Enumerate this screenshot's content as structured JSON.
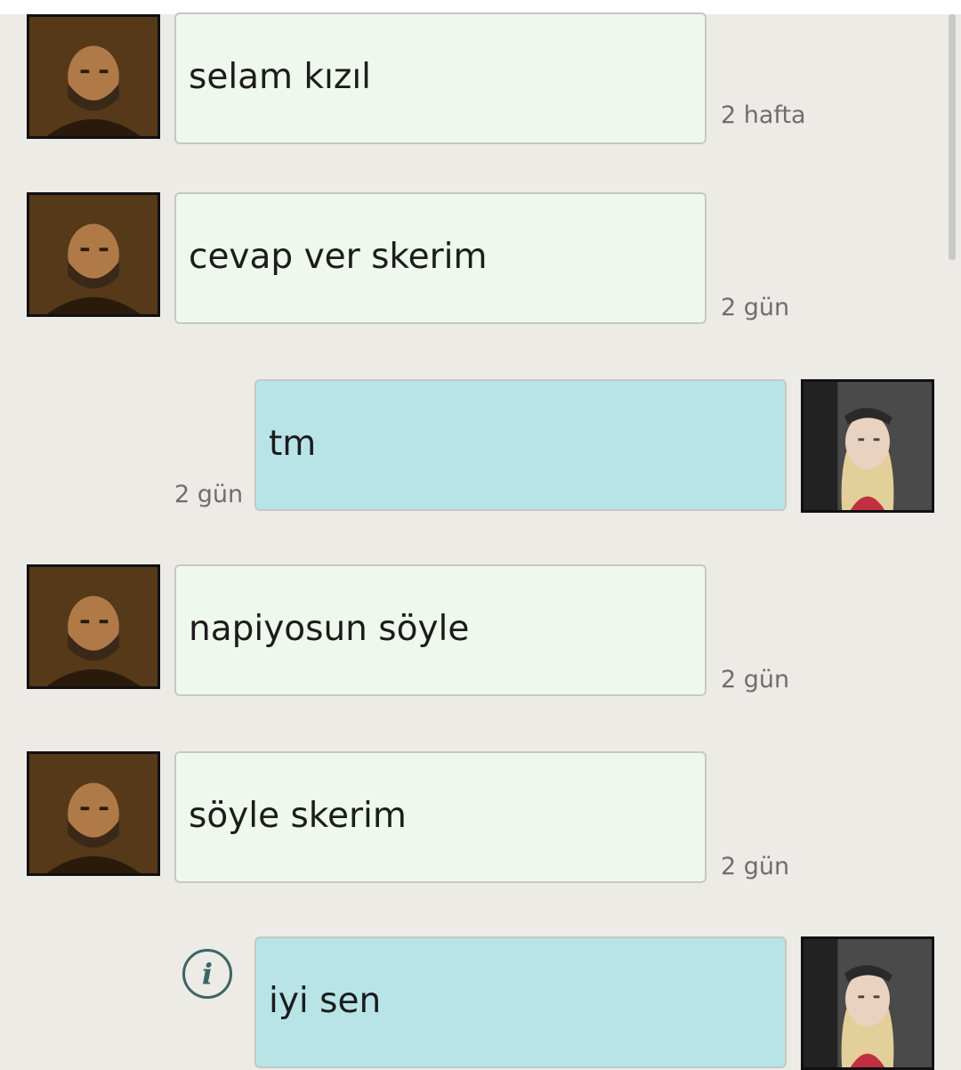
{
  "messages": [
    {
      "side": "in",
      "text": "selam kızıl",
      "time": "2 hafta"
    },
    {
      "side": "in",
      "text": "cevap ver skerim",
      "time": "2 gün"
    },
    {
      "side": "out",
      "text": "tm",
      "time": "2 gün"
    },
    {
      "side": "in",
      "text": "napiyosun söyle",
      "time": "2 gün"
    },
    {
      "side": "in",
      "text": "söyle skerim",
      "time": "2 gün"
    },
    {
      "side": "out",
      "text": "iyi sen",
      "time": ""
    }
  ],
  "info_icon": {
    "name": "info-icon",
    "glyph": "i"
  },
  "colors": {
    "incoming_bubble": "#eff8ec",
    "outgoing_bubble": "#b8e4e7",
    "background": "#ecebe6"
  }
}
